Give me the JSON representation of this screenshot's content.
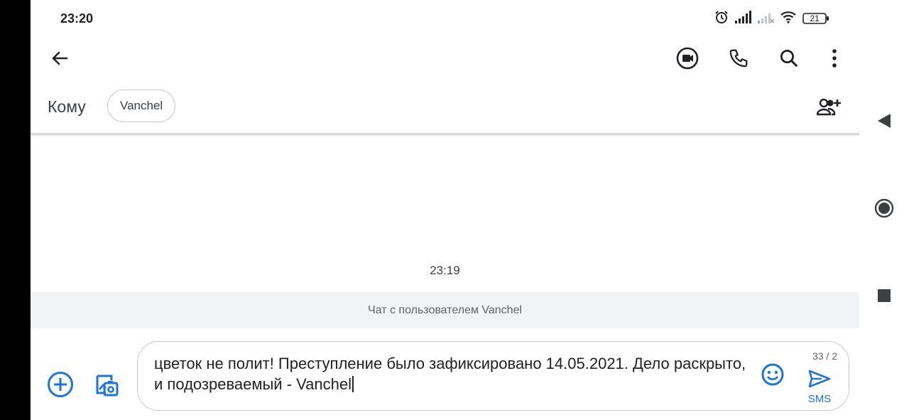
{
  "status_bar": {
    "time": "23:20",
    "battery": "21",
    "icons": [
      "alarm-icon",
      "signal-icon",
      "signal-weak-icon",
      "wifi-icon",
      "battery-icon"
    ]
  },
  "toolbar": {
    "icons": [
      "back-arrow-icon",
      "video-call-icon",
      "phone-icon",
      "search-icon",
      "more-vert-icon"
    ]
  },
  "recipients": {
    "label": "Кому",
    "chip": "Vanchel",
    "add_icon": "add-contact-icon"
  },
  "conversation": {
    "timestamp": "23:19",
    "info": "Чат с пользователем Vanchel"
  },
  "compose": {
    "text": "цветок не полит! Преступление было зафиксировано 14.05.2021. Дело раскрыто, и подозреваемый - Vanchel",
    "counter": "33 / 2",
    "send_label": "SMS",
    "icons": [
      "add-circle-icon",
      "gallery-icon",
      "emoji-icon",
      "send-icon"
    ]
  },
  "nav": {
    "icons": [
      "nav-back-icon",
      "nav-home-icon",
      "nav-recents-icon"
    ]
  },
  "colors": {
    "accent": "#1a73e8",
    "icon": "#202124",
    "muted": "#5f6368",
    "background": "#ffffff",
    "chat_info_bg": "#f1f3f4"
  }
}
